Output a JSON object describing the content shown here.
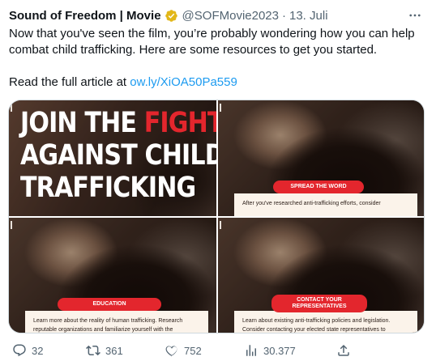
{
  "author": {
    "display_name": "Sound of Freedom | Movie",
    "handle": "@SOFMovie2023",
    "separator": "·",
    "date": "13. Juli",
    "verified_color": "#e2b719"
  },
  "tweet": {
    "text": "Now that you've seen the film, you’re probably wondering how you can help combat child trafficking. Here are some resources to get you started.",
    "read_prefix": "Read the full article at",
    "link_text": "ow.ly/XiOA50Pa559",
    "link_color": "#1d9bf0"
  },
  "media": {
    "headline": {
      "line1_white": "JOIN THE",
      "line1_red": "FIGHT",
      "line2": "AGAINST CHILD",
      "line3": "TRAFFICKING"
    },
    "tiles": [
      {
        "pill": "SPREAD THE WORD",
        "text": "After you've researched anti-trafficking efforts, consider"
      },
      {
        "pill": "EDUCATION",
        "text": "Learn more about the reality of human trafficking. Research reputable organizations and familiarize yourself with the"
      },
      {
        "pill": "CONTACT YOUR REPRESENTATIVES",
        "text": "Learn about existing anti-trafficking policies and legislation. Consider contacting your elected state representatives to"
      }
    ],
    "accent_color": "#e3262d"
  },
  "actions": {
    "replies": "32",
    "retweets": "361",
    "likes": "752",
    "views": "30.377"
  },
  "menu": {
    "more_icon": "more-horizontal-icon"
  }
}
